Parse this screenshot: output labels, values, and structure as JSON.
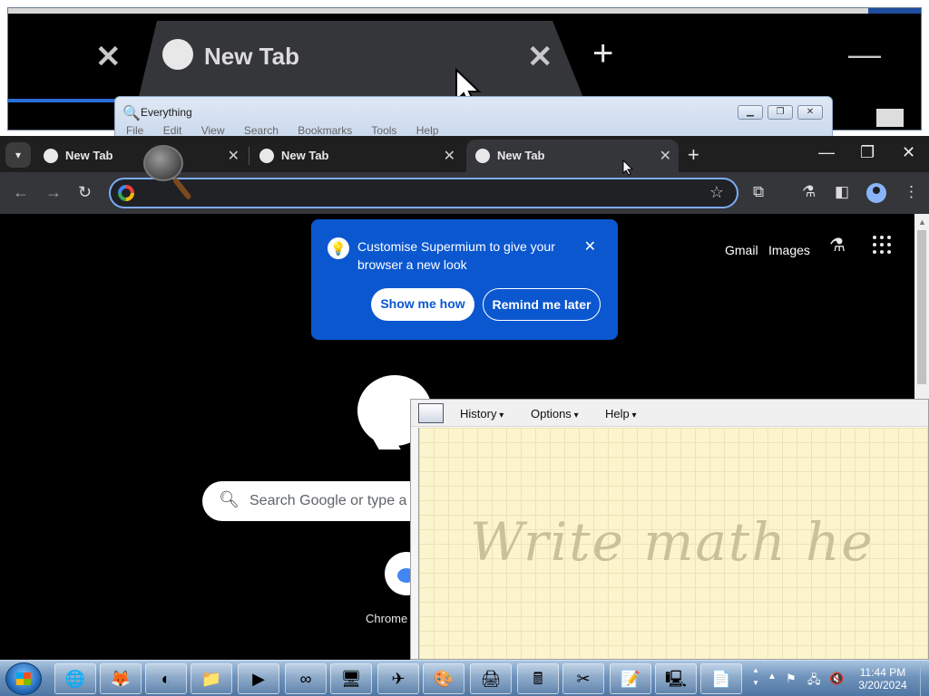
{
  "magnifier": {
    "tab_title": "New Tab",
    "close_glyph": "✕",
    "plus_glyph": "+",
    "minimize_glyph": "—"
  },
  "everything_window": {
    "title": "Everything",
    "menu": [
      "File",
      "Edit",
      "View",
      "Search",
      "Bookmarks",
      "Tools",
      "Help"
    ]
  },
  "browser": {
    "tabs": [
      {
        "label": "New Tab",
        "active": false
      },
      {
        "label": "New Tab",
        "active": false
      },
      {
        "label": "New Tab",
        "active": true
      }
    ],
    "omnibox": {
      "value": ""
    },
    "top_links": {
      "gmail": "Gmail",
      "images": "Images"
    },
    "promo": {
      "text": "Customise Supermium to give your browser a new look",
      "primary_button": "Show me how",
      "secondary_button": "Remind me later"
    },
    "search": {
      "placeholder": "Search Google or type a U"
    },
    "shortcut_label": "Chrome"
  },
  "math_input_panel": {
    "menus": [
      "History",
      "Options",
      "Help"
    ],
    "hint": "Write math he"
  },
  "taskbar": {
    "clock_time": "11:44 PM",
    "clock_date": "3/20/2024",
    "apps": [
      "ie-icon",
      "firefox-icon",
      "browser-icon",
      "explorer-icon",
      "media-player-icon",
      "infinity-icon",
      "network-search-icon",
      "paper-plane-icon",
      "paint-icon",
      "fax-icon",
      "calculator-icon",
      "snipping-icon",
      "sticky-notes-icon",
      "remote-desktop-icon",
      "notepad-icon"
    ]
  },
  "colors": {
    "promo_bg": "#0b57d0",
    "omnibox_border": "#7cacf8",
    "math_canvas": "#fcf4cc"
  }
}
